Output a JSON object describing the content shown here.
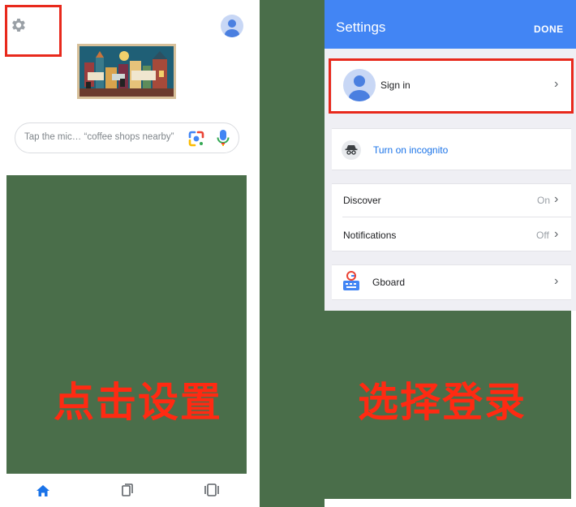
{
  "colors": {
    "accent_blue": "#4285f4",
    "link_blue": "#1a73e8",
    "highlight_red": "#e8291c",
    "caption_red": "#ff2a12",
    "overlay_green": "#4a6e4a"
  },
  "left": {
    "icons": {
      "settings": "gear-icon",
      "account": "account-avatar-icon",
      "lens": "google-lens-icon",
      "mic": "microphone-icon",
      "home": "home-icon",
      "tabs": "collections-icon",
      "cards": "tab-switcher-icon"
    },
    "search": {
      "placeholder": "Tap the mic… “coffee shops nearby”"
    },
    "caption": "点击设置"
  },
  "right": {
    "header": {
      "title": "Settings",
      "done": "DONE"
    },
    "signin": {
      "label": "Sign in"
    },
    "incognito": {
      "label": "Turn on incognito"
    },
    "rows": {
      "discover": {
        "label": "Discover",
        "value": "On"
      },
      "notifications": {
        "label": "Notifications",
        "value": "Off"
      },
      "gboard": {
        "label": "Gboard"
      }
    },
    "chevron": "›",
    "caption": "选择登录"
  }
}
